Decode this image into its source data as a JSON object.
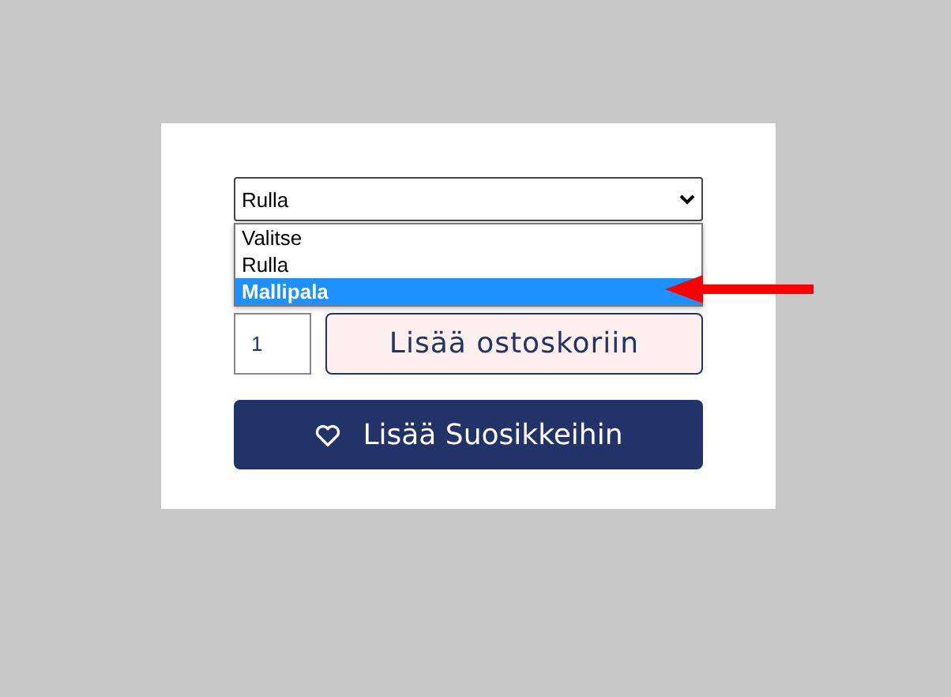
{
  "select": {
    "value": "Rulla",
    "expanded": true,
    "options": [
      {
        "label": "Valitse",
        "highlighted": false
      },
      {
        "label": "Rulla",
        "highlighted": false
      },
      {
        "label": "Mallipala",
        "highlighted": true
      }
    ]
  },
  "quantity": {
    "value": "1"
  },
  "buttons": {
    "add_to_cart": "Lisää ostoskoriin",
    "add_to_favorites": "Lisää Suosikkeihin"
  }
}
